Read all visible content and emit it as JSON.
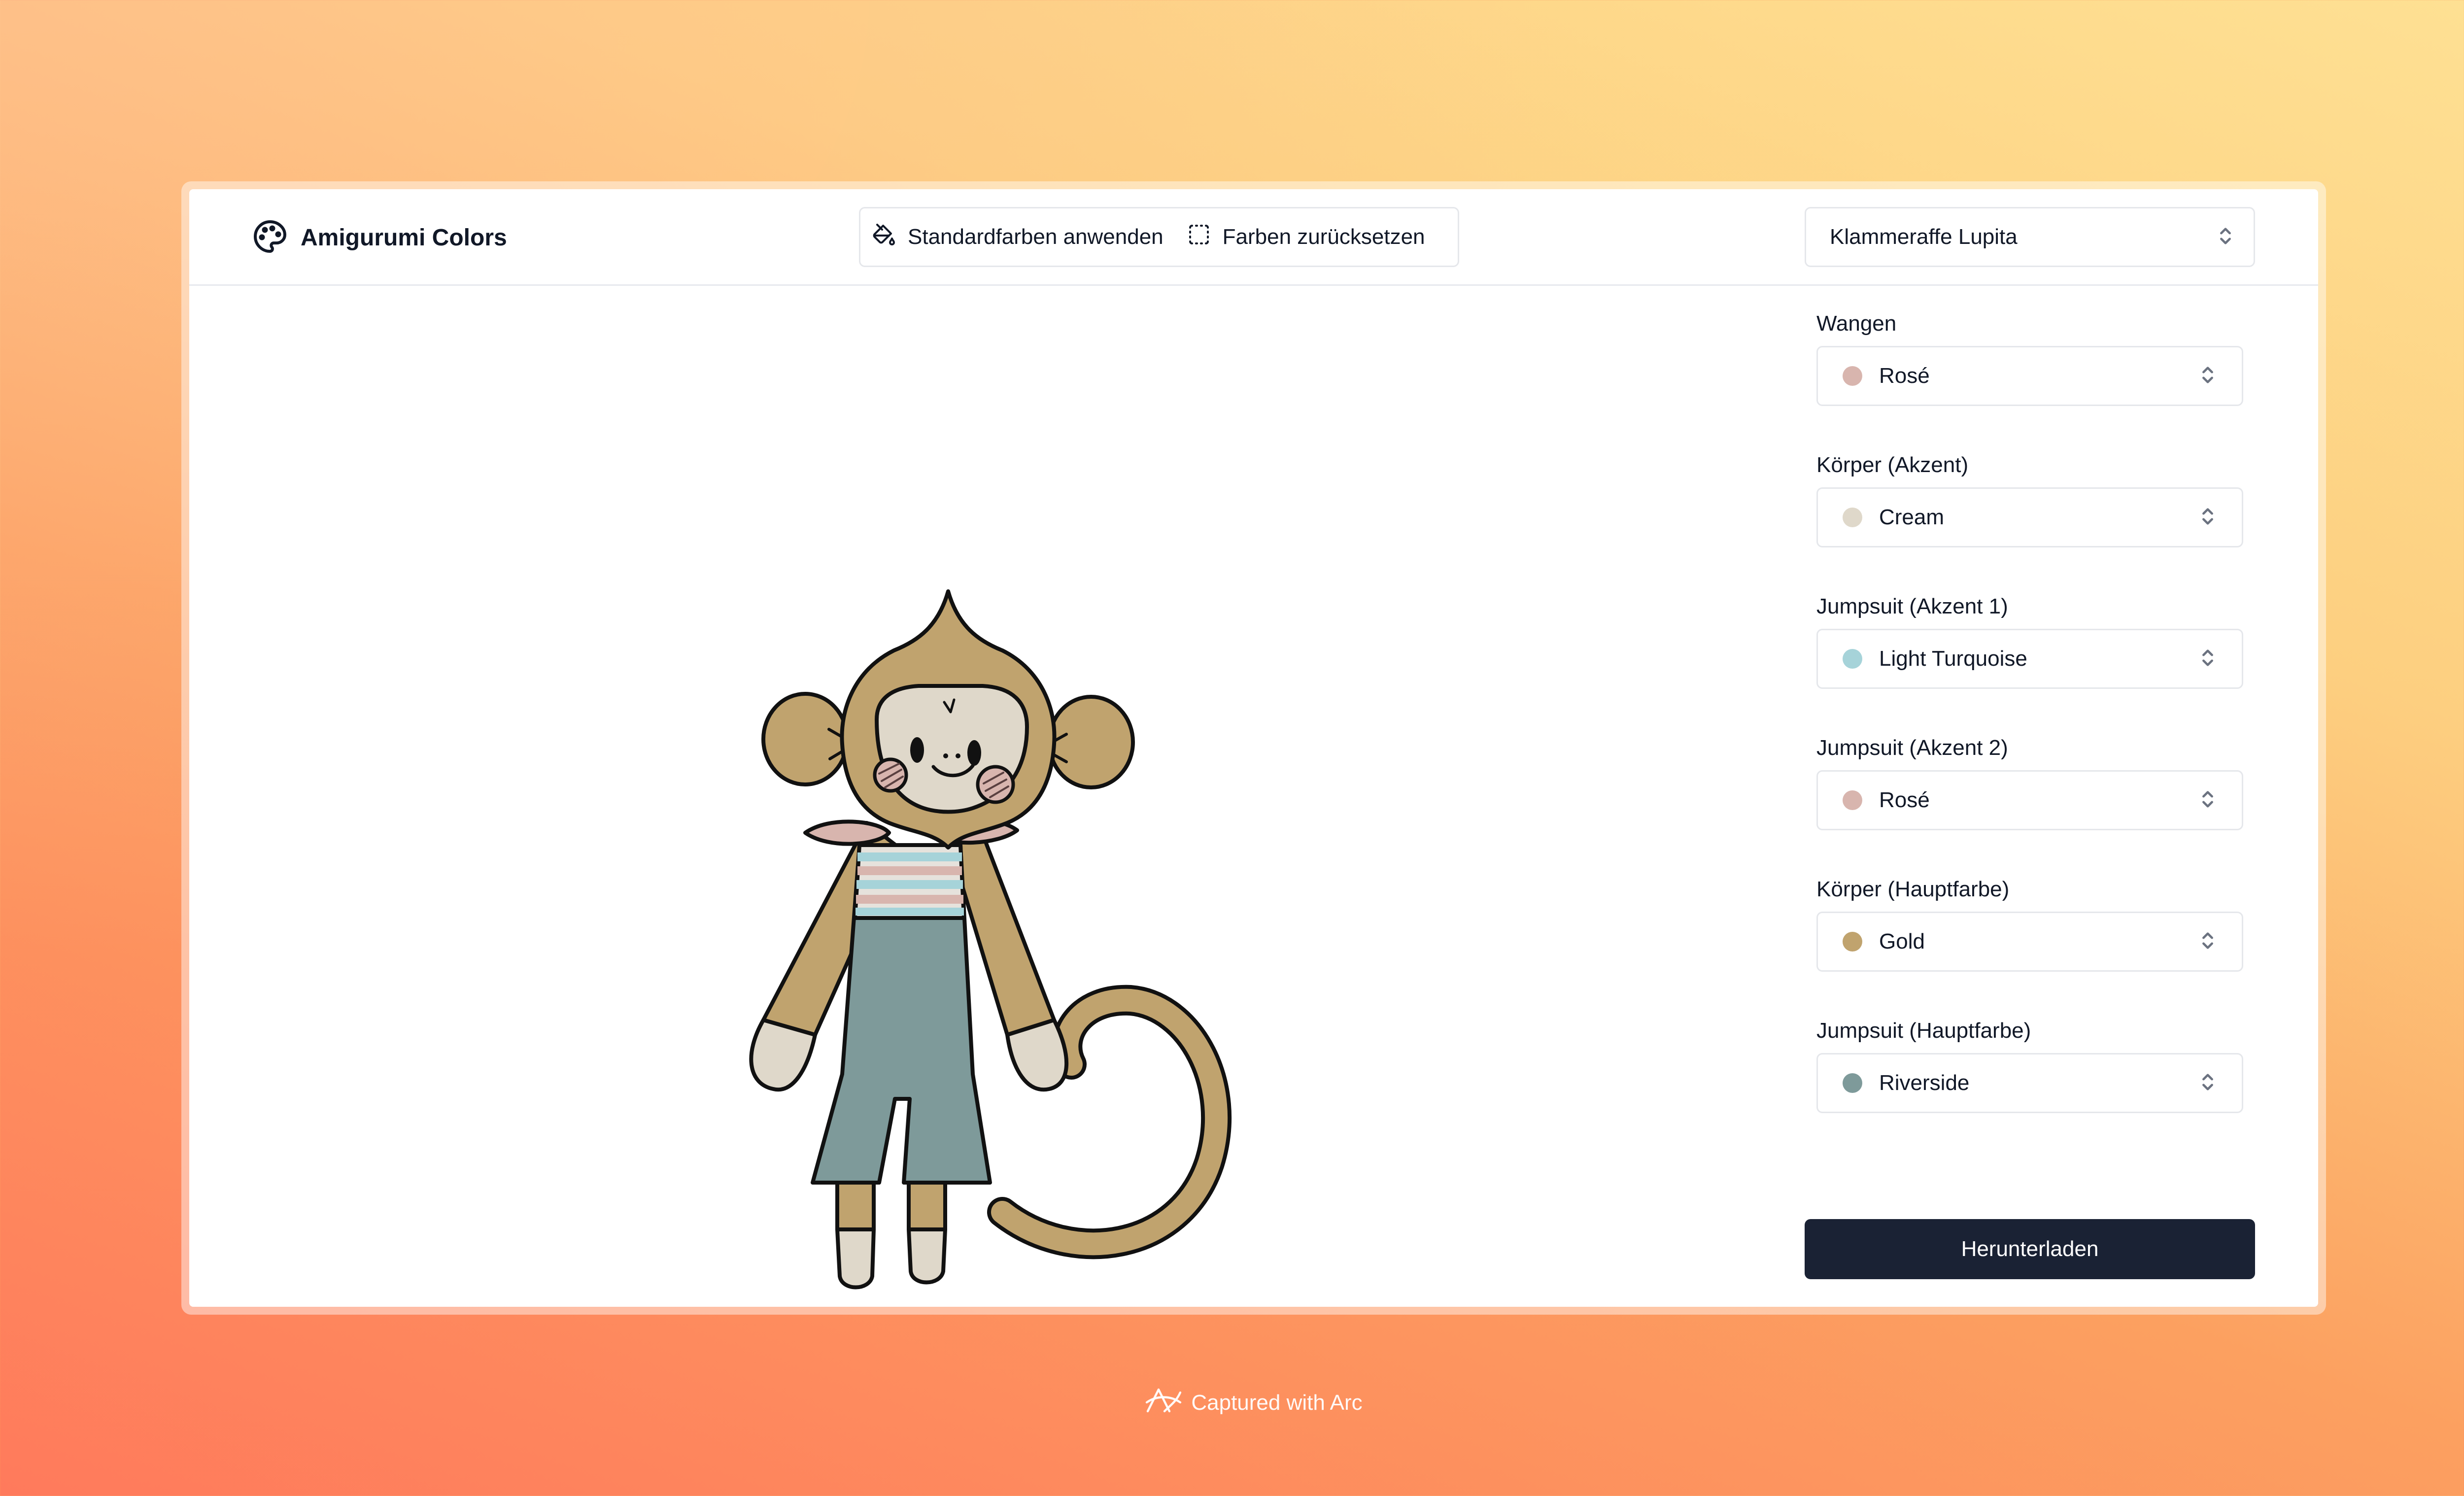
{
  "app": {
    "title": "Amigurumi Colors",
    "icon": "palette-icon"
  },
  "toolbar": {
    "apply_defaults": {
      "label": "Standardfarben anwenden",
      "icon": "paint-bucket-icon"
    },
    "reset_colors": {
      "label": "Farben zurücksetzen",
      "icon": "dashed-square-icon"
    }
  },
  "model_select": {
    "value": "Klammeraffe Lupita",
    "icon": "chevrons-up-down-icon"
  },
  "fields": [
    {
      "label": "Wangen",
      "value": "Rosé",
      "color": "#d8b5ae"
    },
    {
      "label": "Körper (Akzent)",
      "value": "Cream",
      "color": "#dfd8ca"
    },
    {
      "label": "Jumpsuit (Akzent 1)",
      "value": "Light Turquoise",
      "color": "#a6d3d9"
    },
    {
      "label": "Jumpsuit (Akzent 2)",
      "value": "Rosé",
      "color": "#d8b5ae"
    },
    {
      "label": "Körper (Hauptfarbe)",
      "value": "Gold",
      "color": "#c0a36e"
    },
    {
      "label": "Jumpsuit (Hauptfarbe)",
      "value": "Riverside",
      "color": "#7e9a9a"
    }
  ],
  "download": {
    "label": "Herunterladen"
  },
  "footer": {
    "text": "Captured with Arc",
    "icon": "arc-logo-icon"
  },
  "illustration": {
    "subject": "amigurumi monkey",
    "colors": {
      "outline": "#111111",
      "body_main": "#c0a36e",
      "body_accent": "#dfd8ca",
      "cheeks": "#d8b5ae",
      "jumpsuit_main": "#7e9a9a",
      "jumpsuit_accent_1": "#a6d3d9",
      "jumpsuit_accent_2": "#d8b5ae"
    }
  }
}
